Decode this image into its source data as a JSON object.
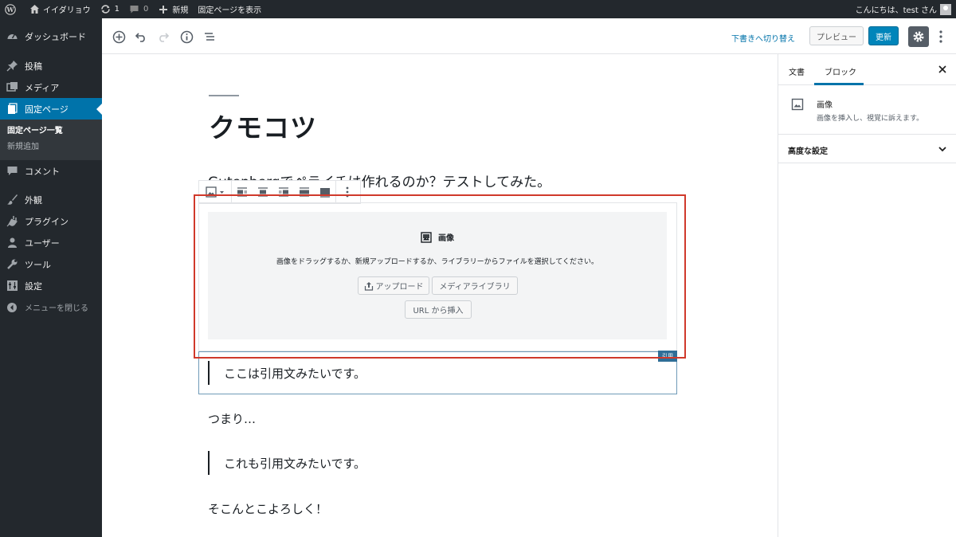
{
  "adminbar": {
    "site_name": "イイダリョウ",
    "updates_count": "1",
    "comments_count": "0",
    "new_label": "新規",
    "view_page_label": "固定ページを表示",
    "greeting": "こんにちは、test さん"
  },
  "sidebar": {
    "items": [
      {
        "label": "ダッシュボード",
        "icon": "dashboard-icon"
      },
      {
        "label": "投稿",
        "icon": "pin-icon"
      },
      {
        "label": "メディア",
        "icon": "media-icon"
      },
      {
        "label": "固定ページ",
        "icon": "page-icon",
        "current": true
      },
      {
        "label": "コメント",
        "icon": "comment-icon"
      },
      {
        "label": "外観",
        "icon": "brush-icon"
      },
      {
        "label": "プラグイン",
        "icon": "plugin-icon"
      },
      {
        "label": "ユーザー",
        "icon": "user-icon"
      },
      {
        "label": "ツール",
        "icon": "wrench-icon"
      },
      {
        "label": "設定",
        "icon": "settings-icon"
      }
    ],
    "submenu": [
      "固定ページ一覧",
      "新規追加"
    ],
    "collapse_label": "メニューを閉じる"
  },
  "topbar": {
    "switch_draft_label": "下書きへ切り替え",
    "preview_label": "プレビュー",
    "update_label": "更新"
  },
  "settings": {
    "tab_document": "文書",
    "tab_block": "ブロック",
    "block_name": "画像",
    "block_description": "画像を挿入し、視覚に訴えます。",
    "advanced_label": "高度な設定"
  },
  "content": {
    "title": "クモコツ",
    "paragraph1": "Gutenbergでペライチは作れるのか？テストしてみた。",
    "image_placeholder": {
      "label": "画像",
      "instructions": "画像をドラッグするか、新規アップロードするか、ライブラリーからファイルを選択してください。",
      "upload_label": "アップロード",
      "media_library_label": "メディアライブラリ",
      "url_insert_label": "URL から挿入"
    },
    "quote1_tag": "引用",
    "quote1": "ここは引用文みたいです。",
    "paragraph2": "つまり…",
    "quote2": "これも引用文みたいです。",
    "paragraph3": "そこんとこよろしく！"
  },
  "colors": {
    "admin_dark": "#23282d",
    "accent_blue": "#0073aa",
    "highlight_red": "#d0392b"
  }
}
